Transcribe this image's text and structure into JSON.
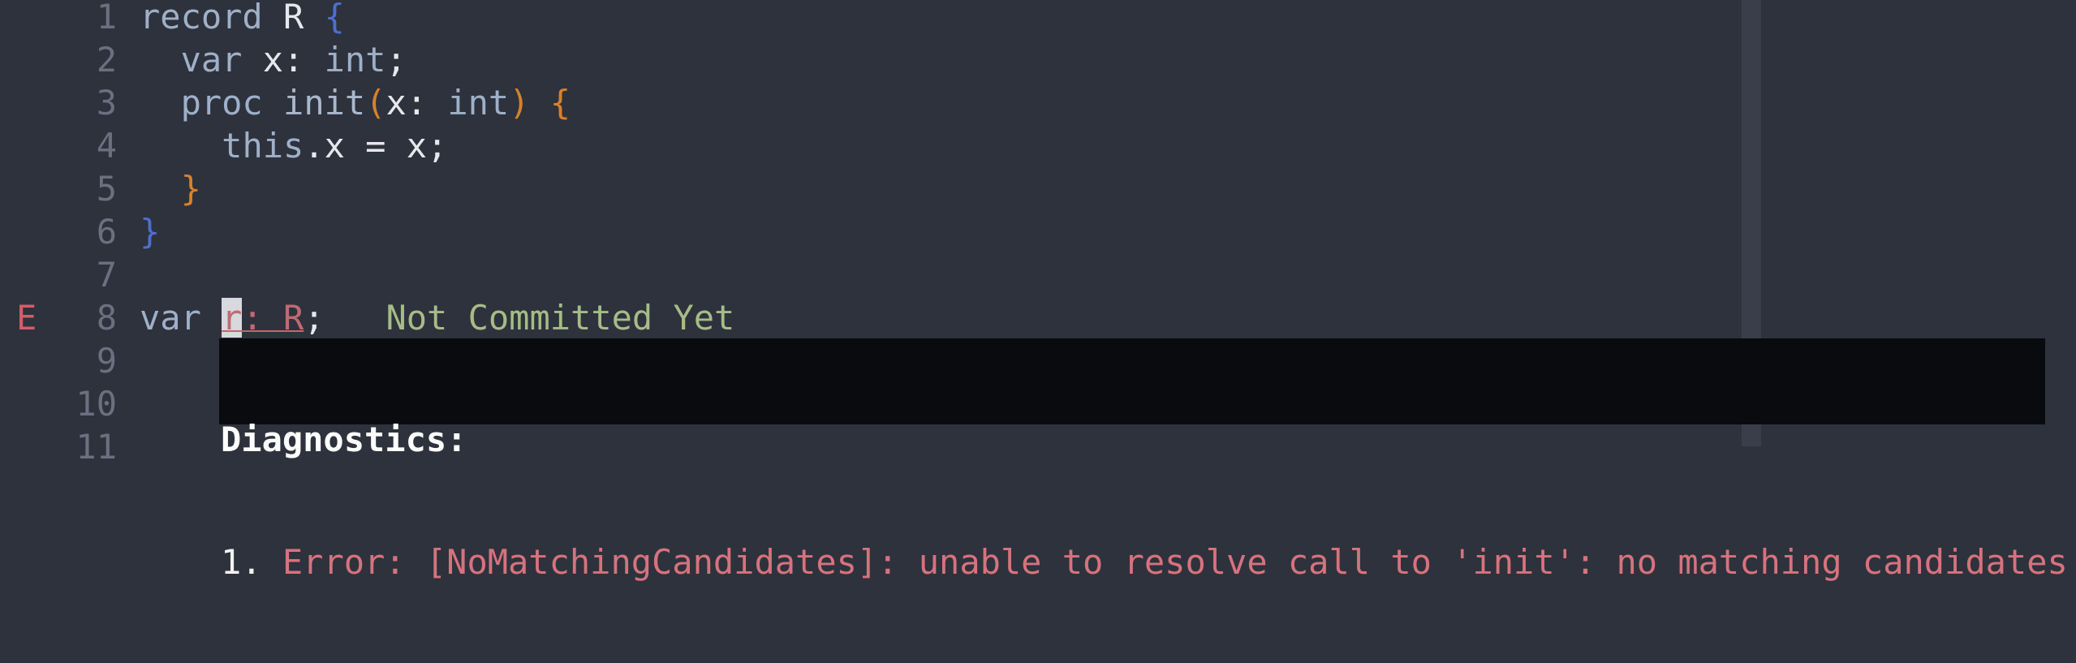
{
  "editor": {
    "lines": [
      {
        "num": "1",
        "sign": "",
        "parts": [
          {
            "t": "record",
            "c": "kw"
          },
          {
            "t": " R ",
            "c": "plain"
          },
          {
            "t": "{",
            "c": "brace-blue"
          }
        ]
      },
      {
        "num": "2",
        "sign": "",
        "parts": [
          {
            "t": "  ",
            "c": "plain"
          },
          {
            "t": "var",
            "c": "kw"
          },
          {
            "t": " x: ",
            "c": "plain"
          },
          {
            "t": "int",
            "c": "ty"
          },
          {
            "t": ";",
            "c": "plain"
          }
        ]
      },
      {
        "num": "3",
        "sign": "",
        "parts": [
          {
            "t": "  ",
            "c": "plain"
          },
          {
            "t": "proc",
            "c": "kw"
          },
          {
            "t": " ",
            "c": "plain"
          },
          {
            "t": "init",
            "c": "fn"
          },
          {
            "t": "(",
            "c": "brace-orange"
          },
          {
            "t": "x: ",
            "c": "plain"
          },
          {
            "t": "int",
            "c": "ty"
          },
          {
            "t": ")",
            "c": "brace-orange"
          },
          {
            "t": " ",
            "c": "plain"
          },
          {
            "t": "{",
            "c": "brace-orange"
          }
        ]
      },
      {
        "num": "4",
        "sign": "",
        "parts": [
          {
            "t": "    ",
            "c": "plain"
          },
          {
            "t": "this",
            "c": "kw"
          },
          {
            "t": ".x = x;",
            "c": "plain"
          }
        ]
      },
      {
        "num": "5",
        "sign": "",
        "parts": [
          {
            "t": "  ",
            "c": "plain"
          },
          {
            "t": "}",
            "c": "brace-orange"
          }
        ]
      },
      {
        "num": "6",
        "sign": "",
        "parts": [
          {
            "t": "}",
            "c": "brace-blue"
          }
        ]
      },
      {
        "num": "7",
        "sign": "",
        "parts": []
      },
      {
        "num": "8",
        "sign": "E",
        "parts": [
          {
            "t": "var",
            "c": "kw"
          },
          {
            "t": " ",
            "c": "plain"
          },
          {
            "t": "r",
            "c": "cursor err-underline"
          },
          {
            "t": ": R",
            "c": "err-underline"
          },
          {
            "t": ";",
            "c": "plain"
          },
          {
            "t": "   Not Committed Yet",
            "c": "virt"
          }
        ]
      },
      {
        "num": "9",
        "sign": "",
        "parts": []
      },
      {
        "num": "10",
        "sign": "",
        "parts": []
      },
      {
        "num": "11",
        "sign": "",
        "parts": []
      }
    ]
  },
  "diagnostics": {
    "title": "Diagnostics:",
    "index": "1.",
    "message": "Error: [NoMatchingCandidates]: unable to resolve call to 'init': no matching candidates"
  },
  "colors": {
    "background": "#2e323d",
    "popup_background": "#0a0b0e",
    "error": "#d6737d",
    "virtual_text": "#a6bc86"
  }
}
